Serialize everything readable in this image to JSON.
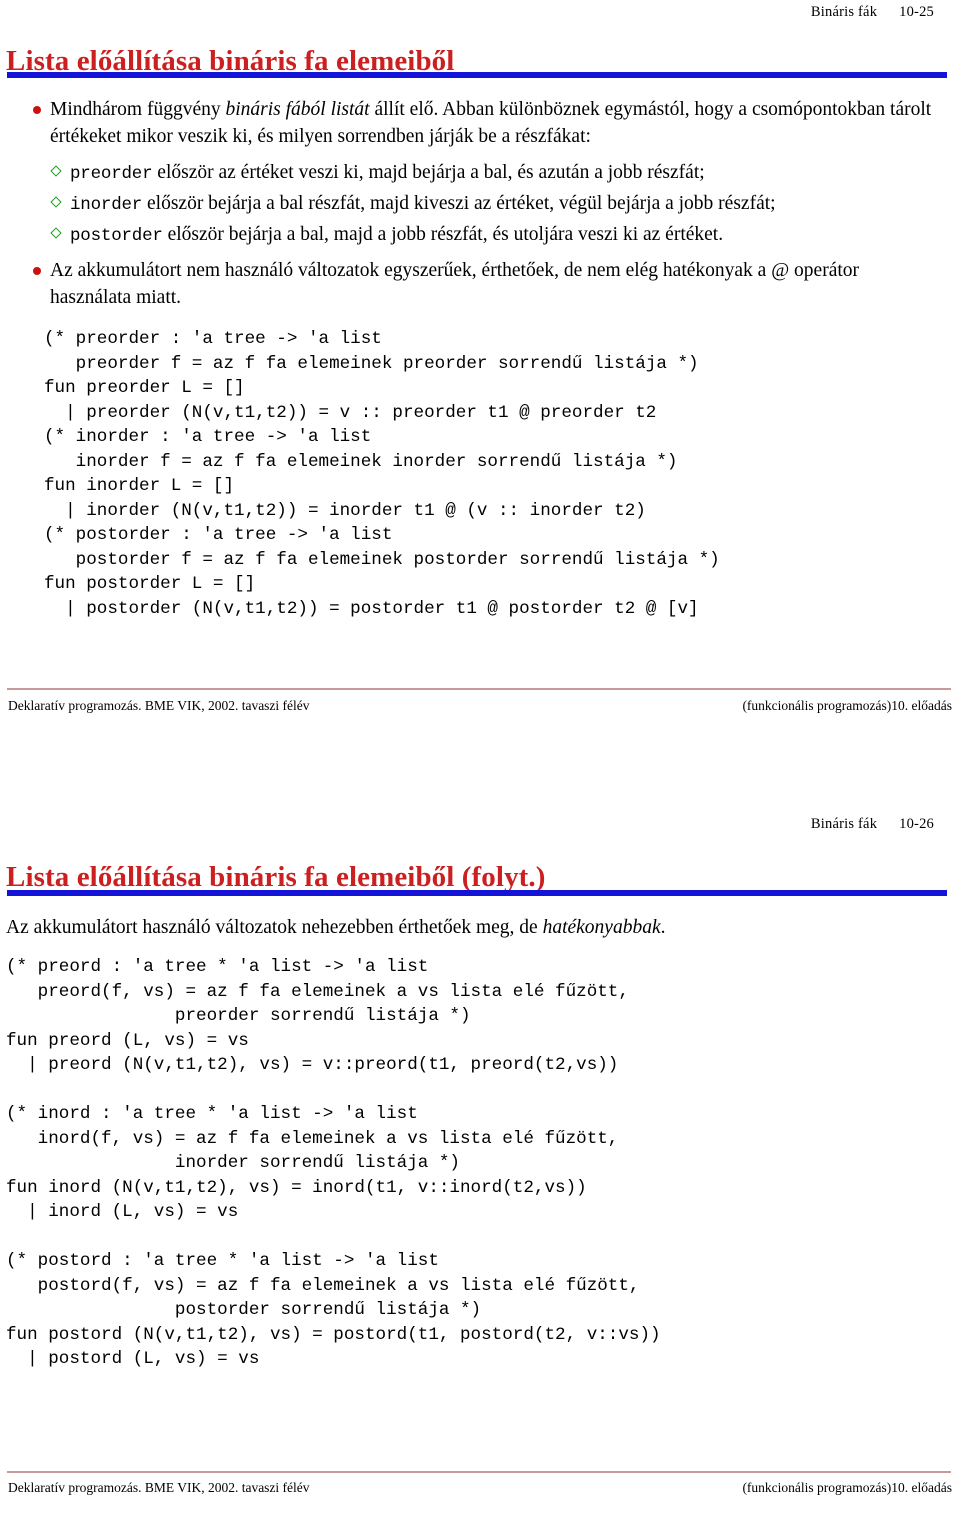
{
  "slides": [
    {
      "header": {
        "topic": "Bináris fák",
        "number": "10-25"
      },
      "title": "Lista előállítása bináris fa elemeiből",
      "bullets": [
        {
          "marker": "red-disc-bullet",
          "text_parts": [
            {
              "text": "Mindhárom függvény ",
              "style": "normal"
            },
            {
              "text": "bináris fából listát",
              "style": "italic"
            },
            {
              "text": " állít elő. Abban különböznek egymástól, hogy a csomópontokban tárolt értékeket mikor veszik ki, és milyen sorrendben járják be a részfákat:",
              "style": "normal"
            }
          ]
        }
      ],
      "subbullets": [
        {
          "marker": "green-diamond-bullet",
          "code": "preorder",
          "text": " először az értéket veszi ki, majd bejárja a bal, és azután a jobb részfát;"
        },
        {
          "marker": "green-diamond-bullet",
          "code": "inorder",
          "text": " először bejárja a bal részfát, majd kiveszi az értéket, végül bejárja a jobb részfát;"
        },
        {
          "marker": "green-diamond-bullet",
          "code": "postorder",
          "text": " először bejárja a bal, majd a jobb részfát, és utoljára veszi ki az értéket."
        }
      ],
      "bullet2": {
        "marker": "red-disc-bullet",
        "text": "Az akkumulátort nem használó változatok egyszerűek, érthetőek, de nem elég hatékonyak a @ operátor használata miatt."
      },
      "code": "(* preorder : 'a tree -> 'a list\n   preorder f = az f fa elemeinek preorder sorrendű listája *)\nfun preorder L = []\n  | preorder (N(v,t1,t2)) = v :: preorder t1 @ preorder t2\n(* inorder : 'a tree -> 'a list\n   inorder f = az f fa elemeinek inorder sorrendű listája *)\nfun inorder L = []\n  | inorder (N(v,t1,t2)) = inorder t1 @ (v :: inorder t2)\n(* postorder : 'a tree -> 'a list\n   postorder f = az f fa elemeinek postorder sorrendű listája *)\nfun postorder L = []\n  | postorder (N(v,t1,t2)) = postorder t1 @ postorder t2 @ [v]",
      "footer": {
        "left": "Deklaratív programozás. BME VIK, 2002. tavaszi félév",
        "right": "(funkcionális programozás)10. előadás"
      }
    },
    {
      "header": {
        "topic": "Bináris fák",
        "number": "10-26"
      },
      "title": "Lista előállítása bináris fa elemeiből (folyt.)",
      "intro_parts": [
        {
          "text": "Az akkumulátort használó változatok nehezebben érthetőek meg, de ",
          "style": "normal"
        },
        {
          "text": "hatékonyabbak",
          "style": "italic"
        },
        {
          "text": ".",
          "style": "normal"
        }
      ],
      "code": "(* preord : 'a tree * 'a list -> 'a list\n   preord(f, vs) = az f fa elemeinek a vs lista elé fűzött,\n                preorder sorrendű listája *)\nfun preord (L, vs) = vs\n  | preord (N(v,t1,t2), vs) = v::preord(t1, preord(t2,vs))\n\n(* inord : 'a tree * 'a list -> 'a list\n   inord(f, vs) = az f fa elemeinek a vs lista elé fűzött,\n                inorder sorrendű listája *)\nfun inord (N(v,t1,t2), vs) = inord(t1, v::inord(t2,vs))\n  | inord (L, vs) = vs\n\n(* postord : 'a tree * 'a list -> 'a list\n   postord(f, vs) = az f fa elemeinek a vs lista elé fűzött,\n                postorder sorrendű listája *)\nfun postord (N(v,t1,t2), vs) = postord(t1, postord(t2, v::vs))\n  | postord (L, vs) = vs",
      "footer": {
        "left": "Deklaratív programozás. BME VIK, 2002. tavaszi félév",
        "right": "(funkcionális programozás)10. előadás"
      }
    }
  ],
  "colors": {
    "title": "#cc2020",
    "title_rule": "#1414d8",
    "bullet_disc": "#cc1111",
    "diamond": "#1aa11a",
    "footer_rule": "#c99a9a"
  }
}
